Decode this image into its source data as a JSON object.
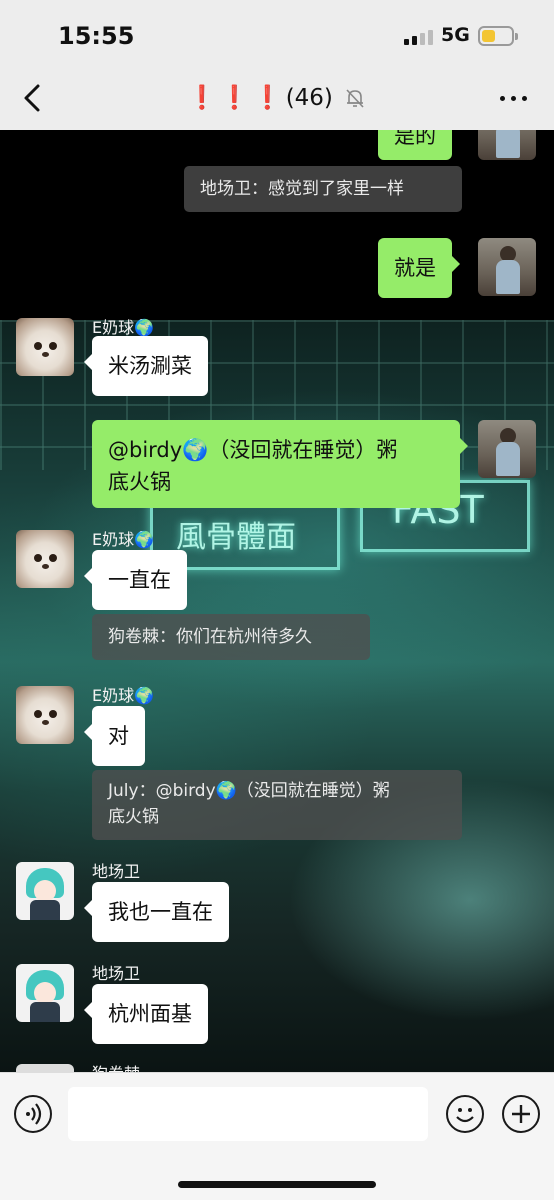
{
  "status_bar": {
    "time": "15:55",
    "network": "5G",
    "battery_level": 0.45,
    "battery_color": "#f3c533"
  },
  "nav": {
    "title_marks": "❗❗❗",
    "member_count": "(46)",
    "icons": [
      "back-chevron-icon",
      "mute-bell-icon",
      "more-icon"
    ]
  },
  "messages": {
    "m1": {
      "text": "是的"
    },
    "m2": {
      "text": "地场卫：感觉到了家里一样"
    },
    "m3": {
      "text": "就是"
    },
    "m4": {
      "sender": "E奶球🌍",
      "text": "米汤涮菜"
    },
    "m5": {
      "line1": "@birdy🌍（没回就在睡觉）粥",
      "line2": "底火锅"
    },
    "m6": {
      "sender": "E奶球🌍",
      "text": "一直在"
    },
    "m7": {
      "text": "狗卷棘：你们在杭州待多久"
    },
    "m8": {
      "sender": "E奶球🌍",
      "text": "对"
    },
    "m9": {
      "line1": "July：@birdy🌍（没回就在睡觉）粥",
      "line2": "底火锅"
    },
    "m10": {
      "sender": "地场卫",
      "text": "我也一直在"
    },
    "m11": {
      "sender": "地场卫",
      "text": "杭州面基"
    },
    "m12": {
      "sender": "狗卷棘"
    }
  },
  "background_sign": {
    "sign1": "風骨體面",
    "sign2": "FAST"
  },
  "input_bar": {
    "value": "",
    "icons": [
      "voice-icon",
      "emoji-icon",
      "plus-icon"
    ]
  },
  "colors": {
    "bubble_green": "#95ec69",
    "bubble_white": "#ffffff",
    "topbar_bg": "#ededed",
    "title_excl": "#e0241b"
  }
}
